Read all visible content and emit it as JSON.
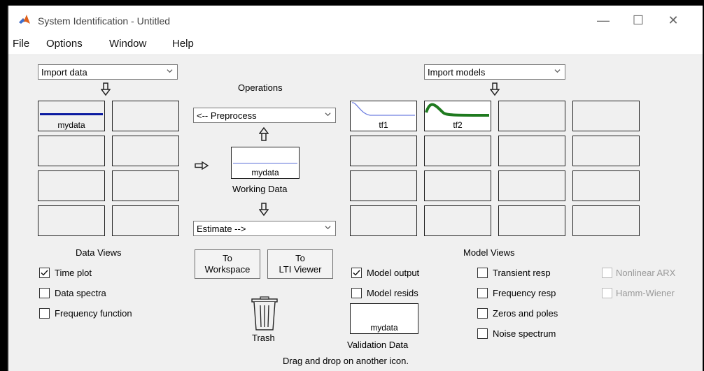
{
  "window": {
    "title": "System Identification - Untitled"
  },
  "menu": {
    "items": [
      "File",
      "Options",
      "Window",
      "Help"
    ]
  },
  "data_panel": {
    "import_combo": "Import data",
    "tiles": [
      "mydata"
    ],
    "views_heading": "Data Views",
    "views": [
      {
        "label": "Time plot",
        "checked": true
      },
      {
        "label": "Data spectra",
        "checked": false
      },
      {
        "label": "Frequency function",
        "checked": false
      }
    ]
  },
  "operations": {
    "heading": "Operations",
    "preprocess_combo": "<-- Preprocess",
    "working_data_name": "mydata",
    "working_data_label": "Working Data",
    "estimate_combo": "Estimate -->",
    "to_workspace_label": "To\nWorkspace",
    "to_lti_viewer_label": "To\nLTI Viewer",
    "trash_label": "Trash"
  },
  "model_panel": {
    "import_combo": "Import models",
    "tiles": [
      "tf1",
      "tf2"
    ],
    "views_heading": "Model Views",
    "views_col1": [
      {
        "label": "Model output",
        "checked": true
      },
      {
        "label": "Model resids",
        "checked": false
      }
    ],
    "views_col2": [
      {
        "label": "Transient resp",
        "checked": false
      },
      {
        "label": "Frequency resp",
        "checked": false
      },
      {
        "label": "Zeros and poles",
        "checked": false
      },
      {
        "label": "Noise spectrum",
        "checked": false
      }
    ],
    "views_col3": [
      {
        "label": "Nonlinear ARX",
        "enabled": false
      },
      {
        "label": "Hamm-Wiener",
        "enabled": false
      }
    ],
    "validation_name": "mydata",
    "validation_label": "Validation Data"
  },
  "status": "Drag and drop on another icon.",
  "colors": {
    "data_line": "#0a1aa0",
    "working_line": "#5b6fd8",
    "tf1_line": "#6f7fe0",
    "tf2_line": "#1f7a1f"
  }
}
